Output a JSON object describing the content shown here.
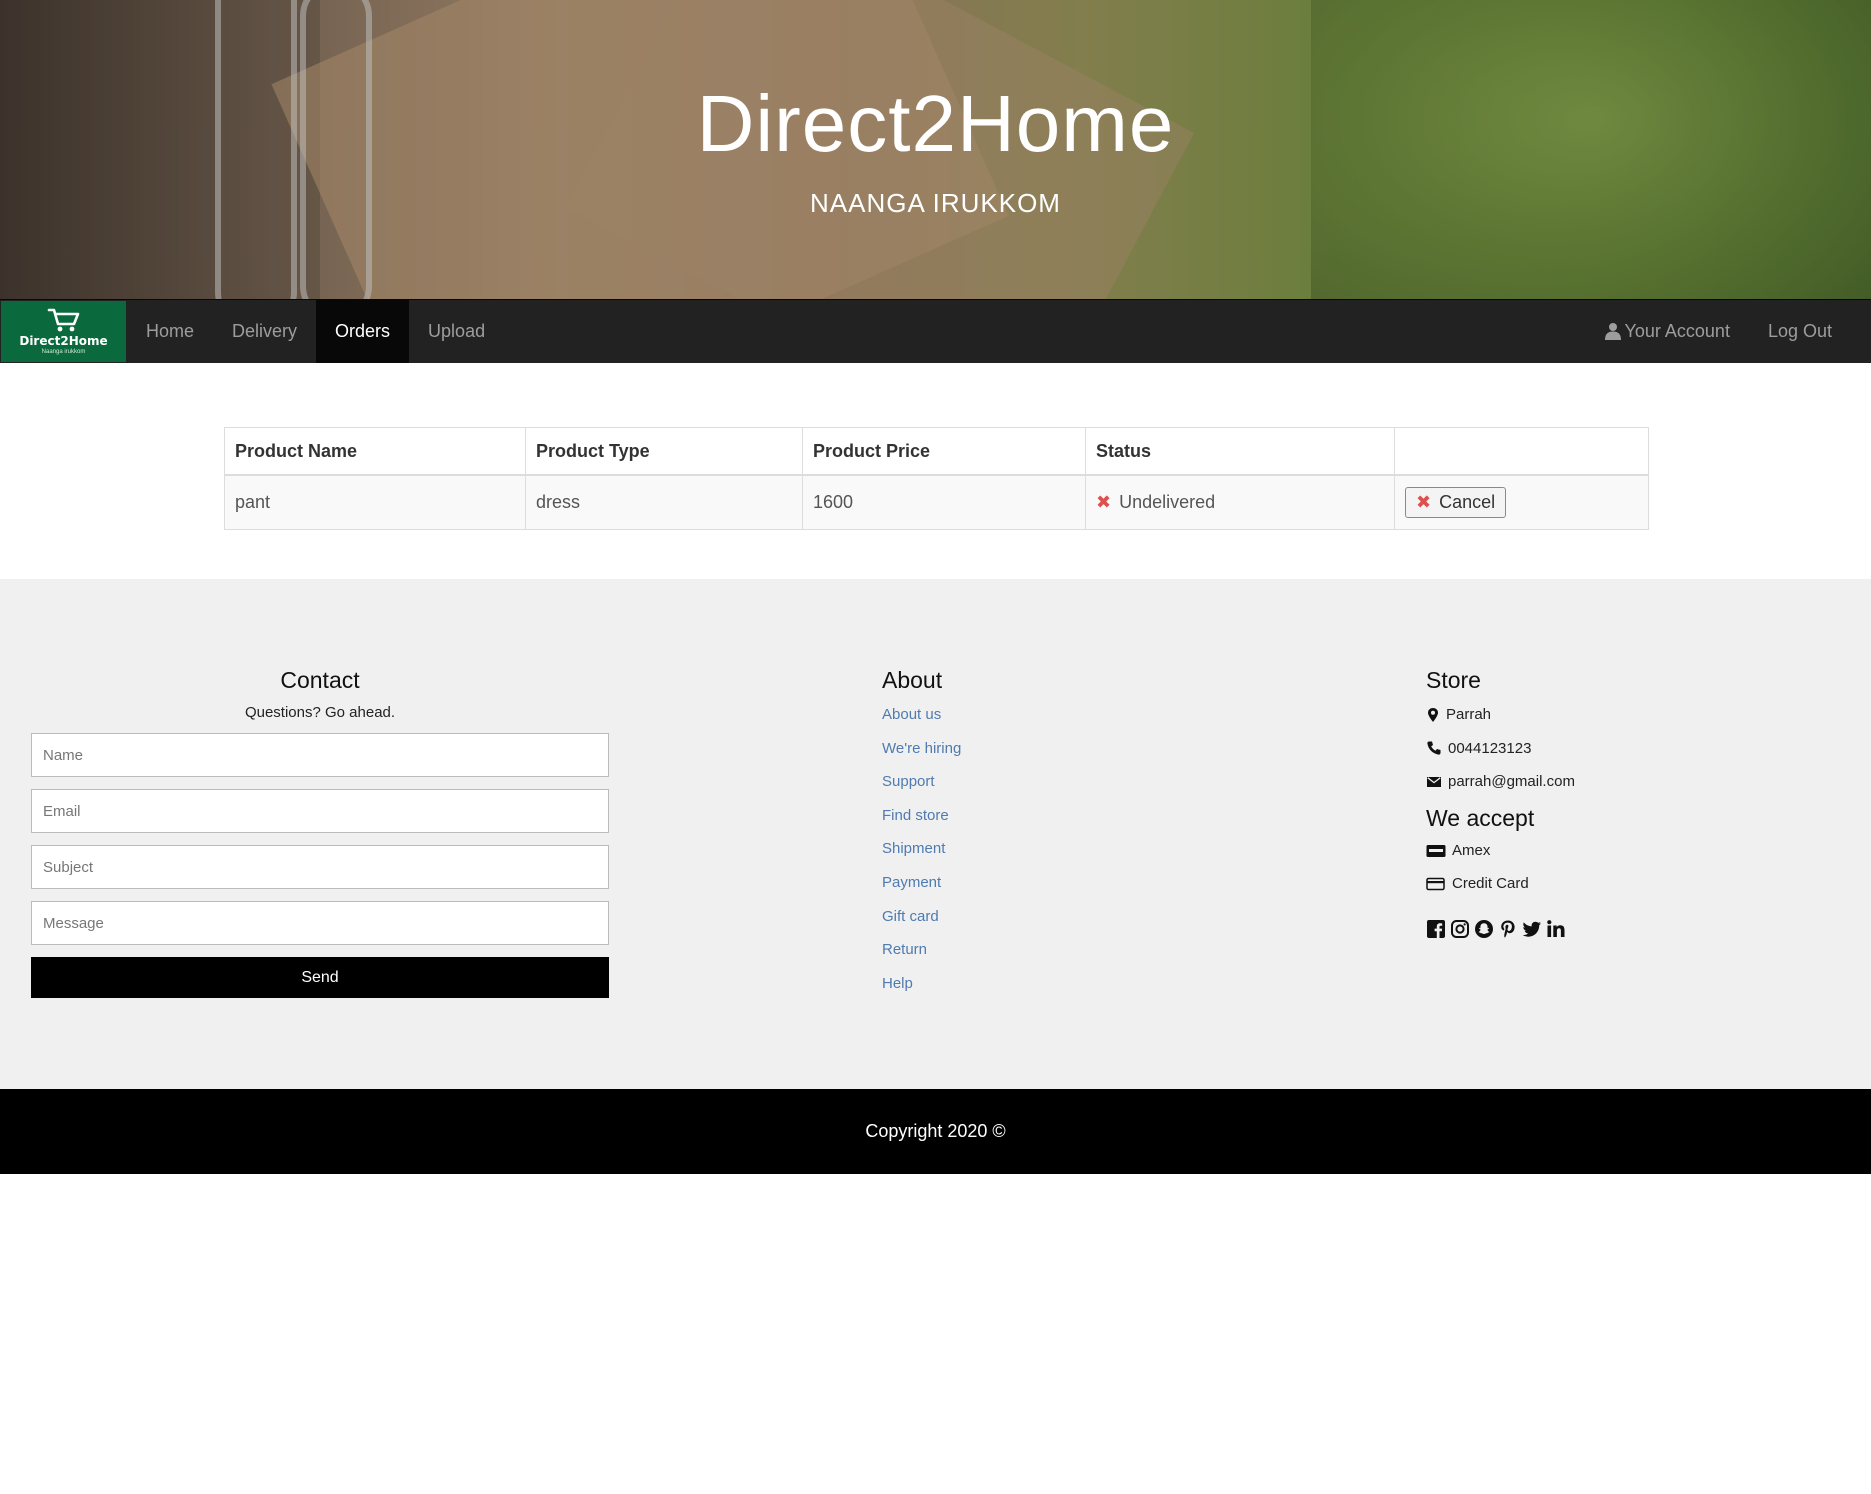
{
  "hero": {
    "title": "Direct2Home",
    "subtitle": "NAANGA IRUKKOM"
  },
  "brand": {
    "name": "Direct2Home",
    "tagline": "Naanga irukkom",
    "icon": "shopping-cart-icon",
    "color": "#0b6a3d"
  },
  "nav": {
    "left": [
      "Home",
      "Delivery",
      "Orders",
      "Upload"
    ],
    "active": "Orders",
    "account": "Your Account",
    "logout": "Log Out"
  },
  "orders": {
    "headers": [
      "Product Name",
      "Product Type",
      "Product Price",
      "Status",
      ""
    ],
    "rows": [
      {
        "name": "pant",
        "type": "dress",
        "price": "1600",
        "status": "Undelivered",
        "action": "Cancel"
      }
    ]
  },
  "contact": {
    "title": "Contact",
    "subtitle": "Questions? Go ahead.",
    "name_placeholder": "Name",
    "email_placeholder": "Email",
    "subject_placeholder": "Subject",
    "message_placeholder": "Message",
    "send_label": "Send"
  },
  "about": {
    "title": "About",
    "links": [
      "About us",
      "We're hiring",
      "Support",
      "Find store",
      "Shipment",
      "Payment",
      "Gift card",
      "Return",
      "Help"
    ]
  },
  "store": {
    "title": "Store",
    "location": "Parrah",
    "phone": "0044123123",
    "email": "parrah@gmail.com",
    "accept_title": "We accept",
    "payments": [
      "Amex",
      "Credit Card"
    ],
    "social_icons": [
      "facebook-icon",
      "instagram-icon",
      "snapchat-icon",
      "pinterest-icon",
      "twitter-icon",
      "linkedin-icon"
    ]
  },
  "footer": {
    "copyright": "Copyright 2020 ©"
  },
  "colors": {
    "navbar": "#222222",
    "nav_active": "#080808",
    "link": "#4f7bb0",
    "danger": "#d9534f",
    "footer_bg": "#f0f0f0"
  }
}
